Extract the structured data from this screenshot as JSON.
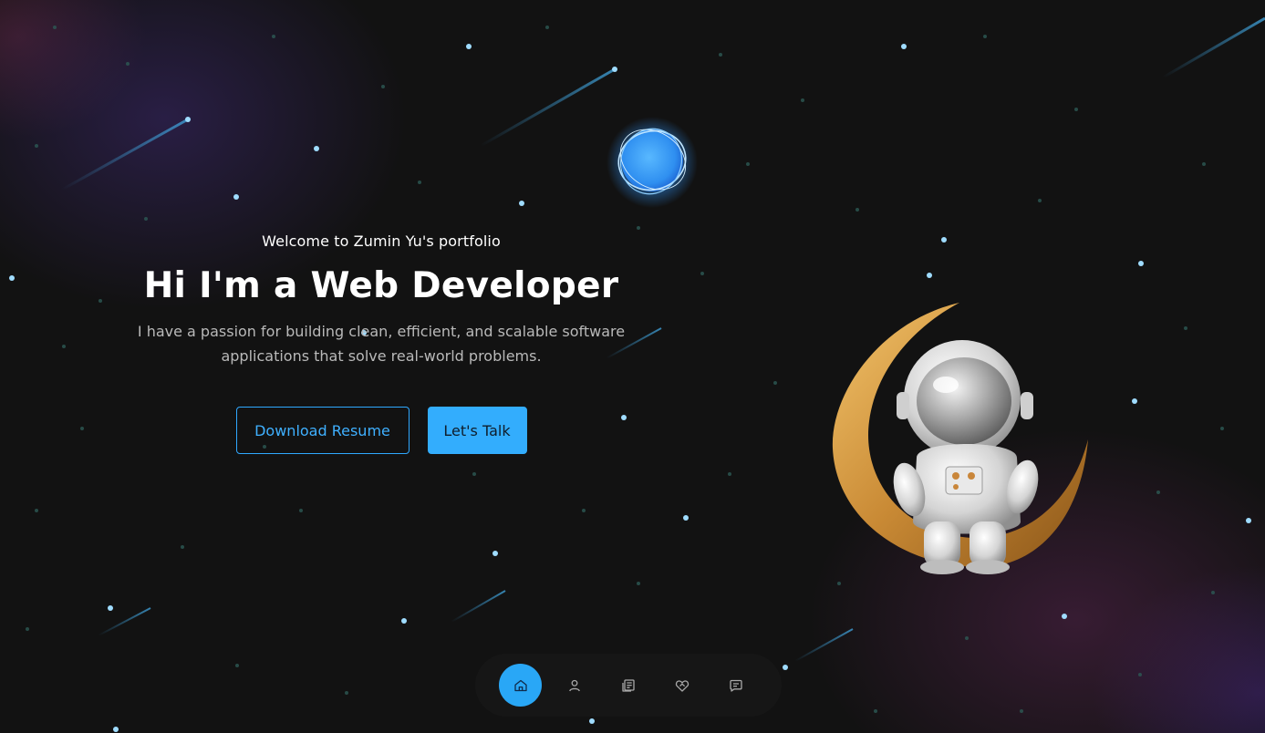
{
  "hero": {
    "welcome": "Welcome to Zumin Yu's portfolio",
    "headline": "Hi I'm a Web Developer",
    "subtitle": "I have a passion for building clean, efficient, and scalable software applications that solve real-world problems.",
    "download_label": "Download Resume",
    "talk_label": "Let's Talk"
  },
  "nav": {
    "active": "home",
    "items": [
      {
        "icon": "home-icon"
      },
      {
        "icon": "user-icon"
      },
      {
        "icon": "articles-icon"
      },
      {
        "icon": "heart-handshake-icon"
      },
      {
        "icon": "message-icon"
      }
    ]
  },
  "colors": {
    "accent": "#33adfd",
    "background": "#121212",
    "text": "#ffffff",
    "muted_text": "#b9b9b9"
  }
}
